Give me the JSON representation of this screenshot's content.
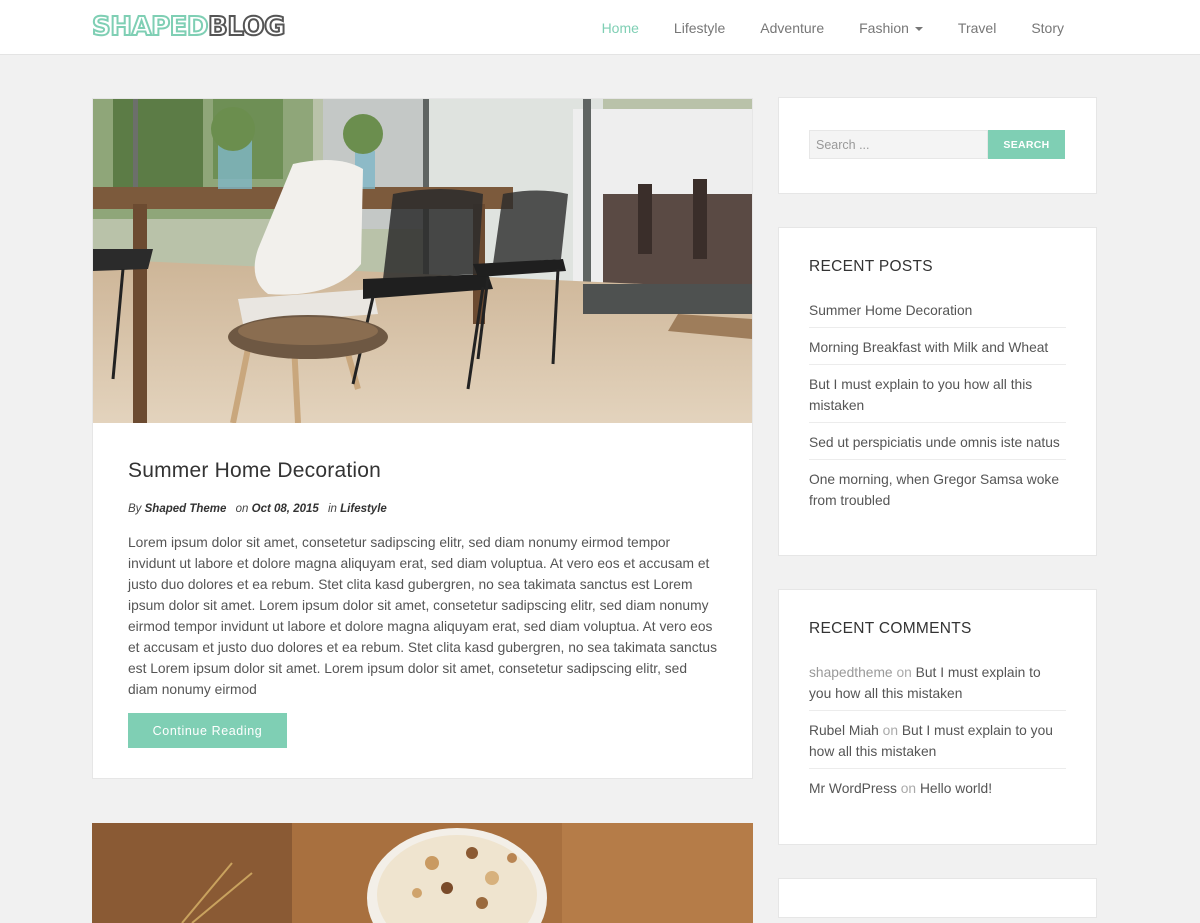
{
  "header": {
    "logo_part1": "SHAPED",
    "logo_part2": "BLOG",
    "nav": [
      "Home",
      "Lifestyle",
      "Adventure",
      "Fashion",
      "Travel",
      "Story"
    ]
  },
  "post": {
    "title": "Summer Home Decoration",
    "by_label": "By",
    "author": "Shaped Theme",
    "on_label": "on",
    "date": "Oct 08, 2015",
    "in_label": "in",
    "category": "Lifestyle",
    "excerpt": "Lorem ipsum dolor sit amet, consetetur sadipscing elitr, sed diam nonumy eirmod tempor invidunt ut labore et dolore magna aliquyam erat, sed diam voluptua. At vero eos et accusam et justo duo dolores et ea rebum. Stet clita kasd gubergren, no sea takimata sanctus est Lorem ipsum dolor sit amet. Lorem ipsum dolor sit amet, consetetur sadipscing elitr, sed diam nonumy eirmod tempor invidunt ut labore et dolore magna aliquyam erat, sed diam voluptua. At vero eos et accusam et justo duo dolores et ea rebum. Stet clita kasd gubergren, no sea takimata sanctus est Lorem ipsum dolor sit amet. Lorem ipsum dolor sit amet, consetetur sadipscing elitr, sed diam nonumy eirmod",
    "continue_label": "Continue Reading"
  },
  "sidebar": {
    "search_placeholder": "Search ...",
    "search_button": "SEARCH",
    "recent_posts_title": "RECENT POSTS",
    "recent_posts": [
      "Summer Home Decoration",
      "Morning Breakfast with Milk and Wheat",
      "But I must explain to you how all this mistaken",
      "Sed ut perspiciatis unde omnis iste natus",
      "One morning, when Gregor Samsa woke from troubled"
    ],
    "recent_comments_title": "RECENT COMMENTS",
    "comments": [
      {
        "author": "shapedtheme",
        "on": "on",
        "post": "But I must explain to you how all this mistaken"
      },
      {
        "author": "Rubel Miah",
        "on": "on",
        "post": "But I must explain to you how all this mistaken"
      },
      {
        "author": "Mr WordPress",
        "on": "on",
        "post": "Hello world!"
      }
    ]
  },
  "colors": {
    "accent": "#7fcfb4",
    "background": "#f1f1f1",
    "text": "#555555"
  },
  "icons": {
    "dropdown": "caret-down-icon"
  }
}
